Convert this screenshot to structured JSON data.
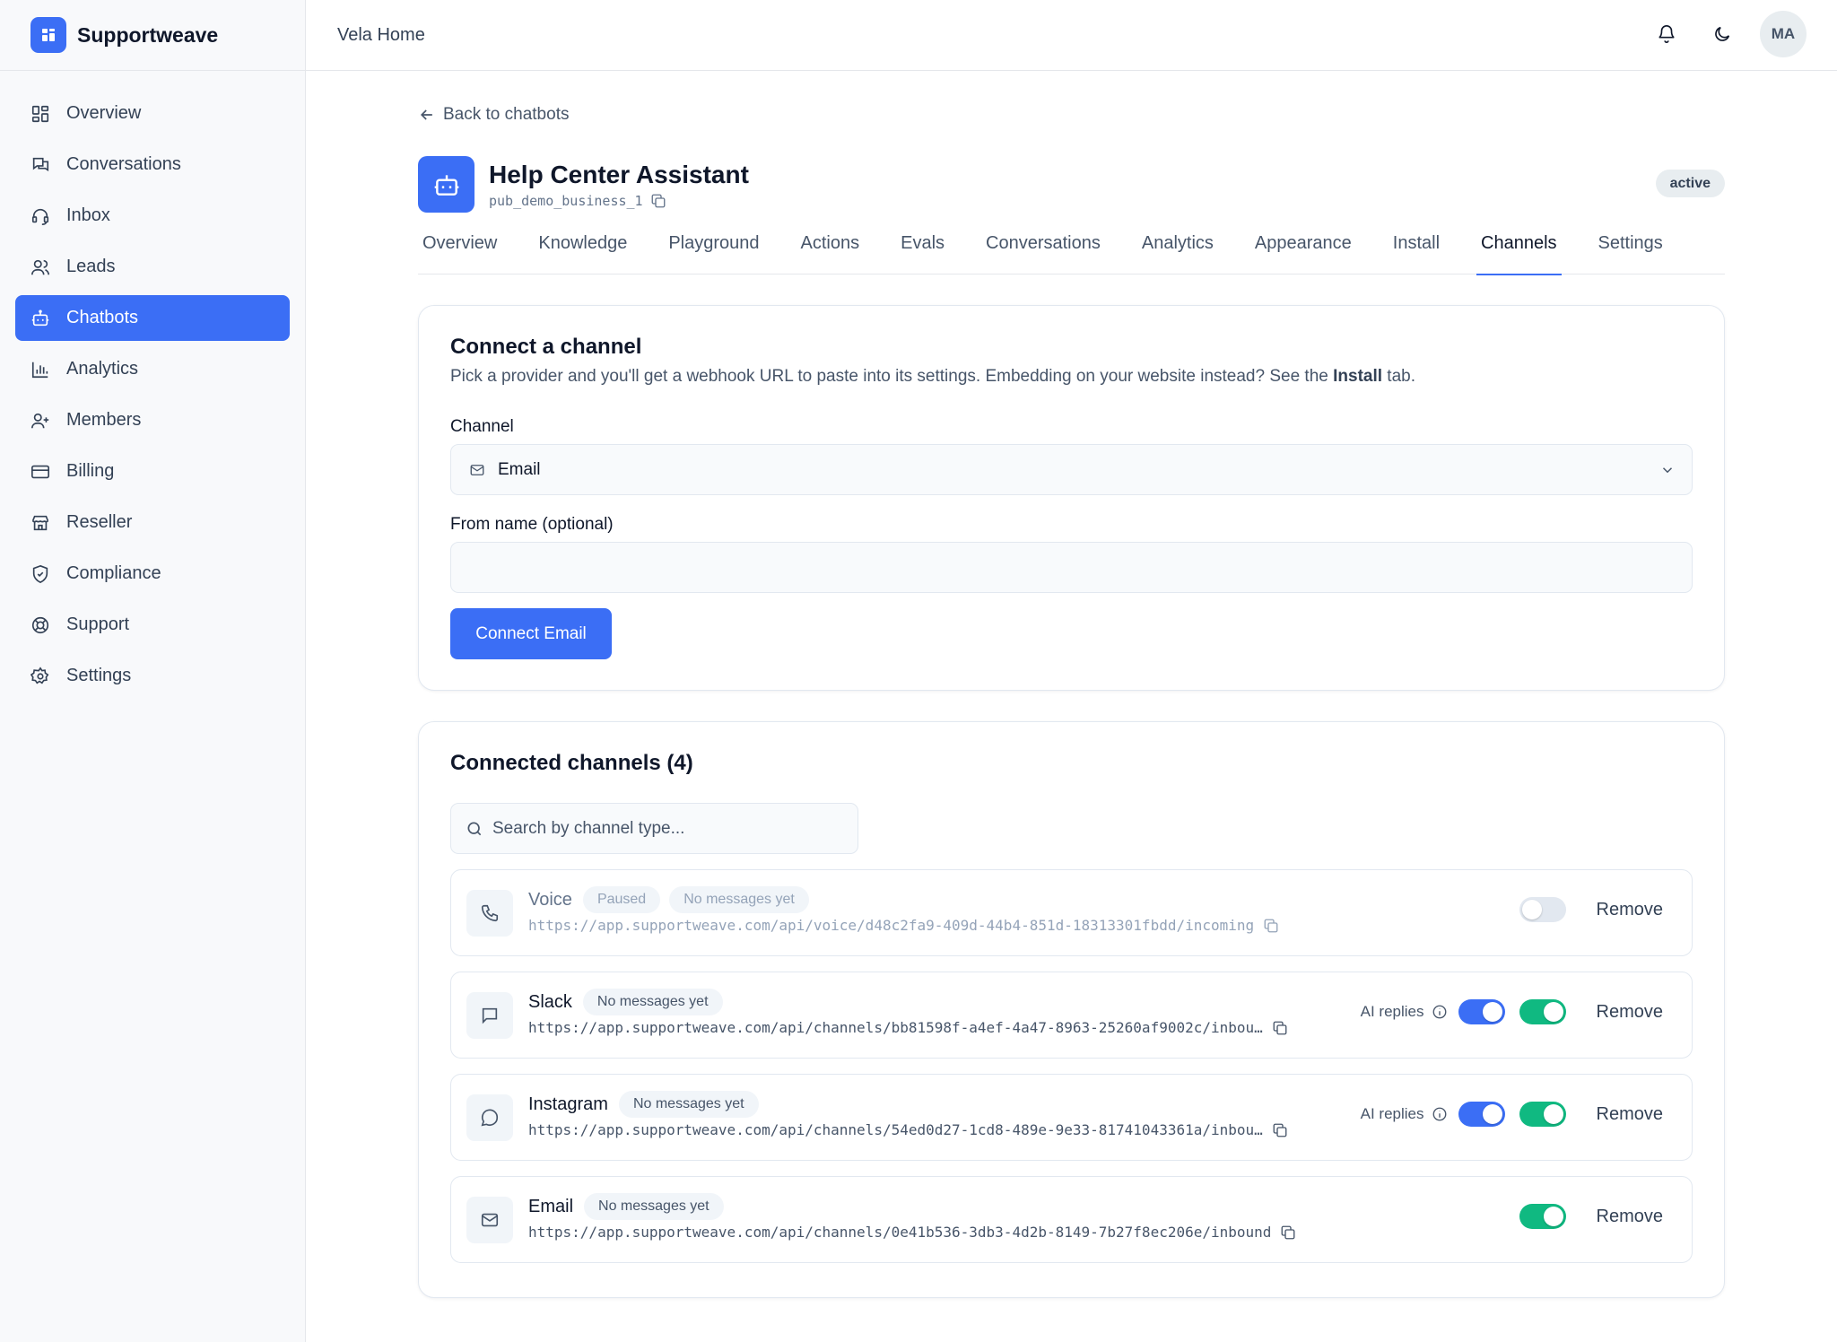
{
  "app": {
    "name": "Supportweave"
  },
  "sidebar": {
    "items": [
      {
        "label": "Overview",
        "icon": "grid-icon"
      },
      {
        "label": "Conversations",
        "icon": "chat-icon"
      },
      {
        "label": "Inbox",
        "icon": "headset-icon"
      },
      {
        "label": "Leads",
        "icon": "users-icon"
      },
      {
        "label": "Chatbots",
        "icon": "bot-icon",
        "active": true
      },
      {
        "label": "Analytics",
        "icon": "bar-chart-icon"
      },
      {
        "label": "Members",
        "icon": "user-plus-icon"
      },
      {
        "label": "Billing",
        "icon": "credit-card-icon"
      },
      {
        "label": "Reseller",
        "icon": "store-icon"
      },
      {
        "label": "Compliance",
        "icon": "shield-icon"
      },
      {
        "label": "Support",
        "icon": "lifebuoy-icon"
      },
      {
        "label": "Settings",
        "icon": "gear-icon"
      }
    ]
  },
  "topbar": {
    "title": "Vela Home",
    "avatar": "MA"
  },
  "page": {
    "back_label": "Back to chatbots",
    "bot_name": "Help Center Assistant",
    "bot_id": "pub_demo_business_1",
    "status": "active"
  },
  "tabs": [
    "Overview",
    "Knowledge",
    "Playground",
    "Actions",
    "Evals",
    "Conversations",
    "Analytics",
    "Appearance",
    "Install",
    "Channels",
    "Settings"
  ],
  "active_tab": "Channels",
  "connect": {
    "title": "Connect a channel",
    "desc_prefix": "Pick a provider and you'll get a webhook URL to paste into its settings. Embedding on your website instead? See the ",
    "desc_bold": "Install",
    "desc_suffix": " tab.",
    "channel_label": "Channel",
    "channel_value": "Email",
    "from_label": "From name (optional)",
    "from_value": "",
    "button": "Connect Email"
  },
  "connected": {
    "title": "Connected channels (4)",
    "search_placeholder": "Search by channel type...",
    "remove_label": "Remove",
    "ai_label": "AI replies",
    "channels": [
      {
        "name": "Voice",
        "icon": "phone-icon",
        "paused_label": "Paused",
        "messages": "No messages yet",
        "url": "https://app.supportweave.com/api/voice/d48c2fa9-409d-44b4-851d-18313301fbdd/incoming",
        "enabled": false,
        "ai_replies": null
      },
      {
        "name": "Slack",
        "icon": "message-square-icon",
        "messages": "No messages yet",
        "url": "https://app.supportweave.com/api/channels/bb81598f-a4ef-4a47-8963-25260af9002c/inbou…",
        "enabled": true,
        "ai_replies": true
      },
      {
        "name": "Instagram",
        "icon": "message-circle-icon",
        "messages": "No messages yet",
        "url": "https://app.supportweave.com/api/channels/54ed0d27-1cd8-489e-9e33-81741043361a/inbou…",
        "enabled": true,
        "ai_replies": true
      },
      {
        "name": "Email",
        "icon": "mail-icon",
        "messages": "No messages yet",
        "url": "https://app.supportweave.com/api/channels/0e41b536-3db3-4d2b-8149-7b27f8ec206e/inbound",
        "enabled": true,
        "ai_replies": null
      }
    ]
  },
  "colors": {
    "primary": "#3b6ef5",
    "success": "#10b981",
    "sidebar_bg": "#f8f9fb"
  }
}
